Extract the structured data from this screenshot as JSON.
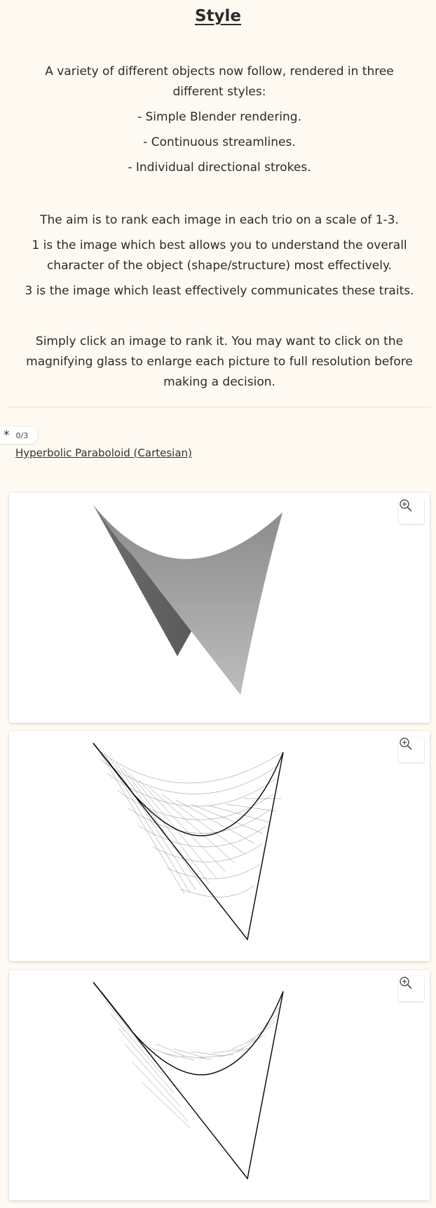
{
  "page": {
    "title": "Style",
    "intro_lines": [
      "A variety of different objects now follow, rendered in three different styles:",
      "- Simple Blender rendering.",
      "- Continuous streamlines.",
      "- Individual directional strokes."
    ],
    "rank_lines": [
      "The aim is to rank each image in each trio on a scale of 1-3.",
      "1 is the image which best allows you to understand the overall character of the object (shape/structure) most effectively.",
      "3 is the image which least effectively communicates these traits."
    ],
    "instruction": "Simply click an image to rank it. You may want to click on the magnifying glass to enlarge each picture to full resolution before making a decision."
  },
  "question": {
    "counter": "0/3",
    "object_name": "Hyperbolic Paraboloid (Cartesian)"
  },
  "images": [
    {
      "style": "Simple Blender rendering",
      "icon": "zoom-in-icon"
    },
    {
      "style": "Continuous streamlines",
      "icon": "zoom-in-icon"
    },
    {
      "style": "Individual directional strokes",
      "icon": "zoom-in-icon"
    }
  ]
}
